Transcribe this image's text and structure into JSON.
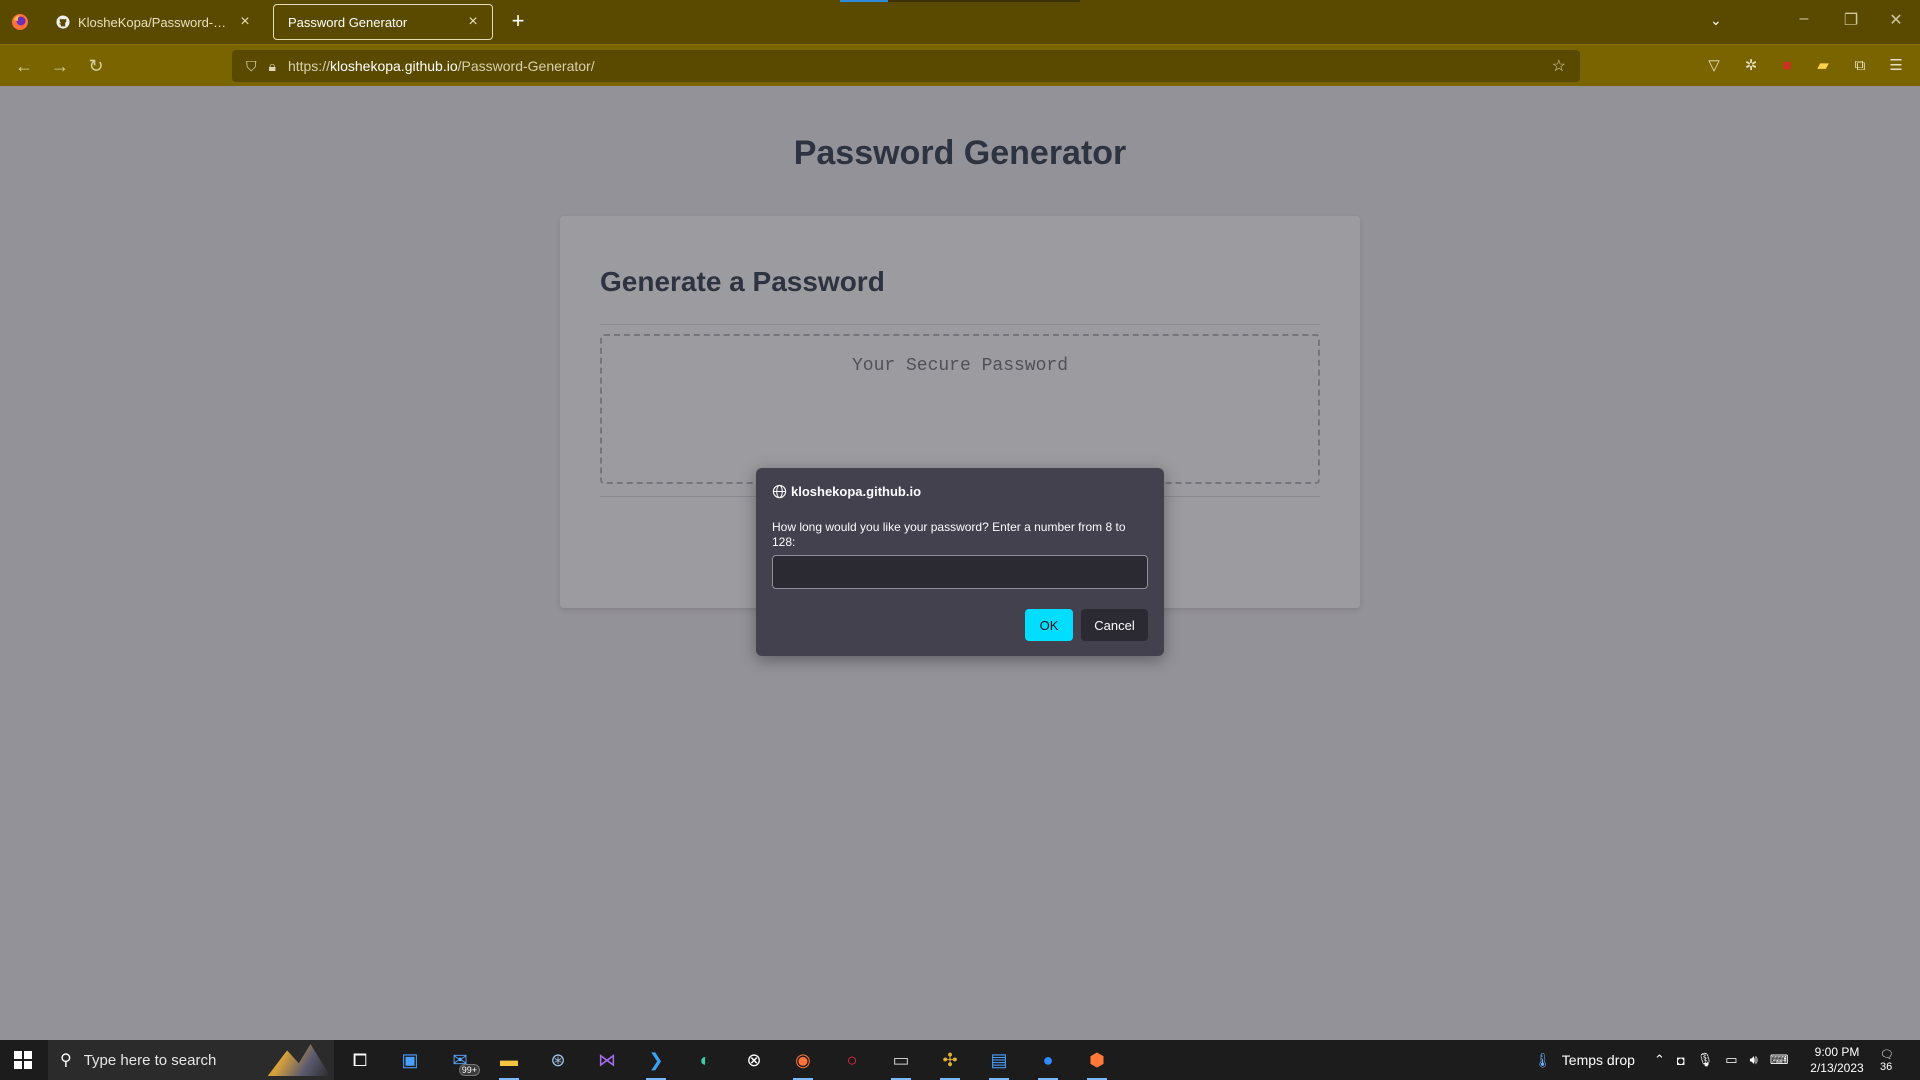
{
  "browser": {
    "tabs": [
      {
        "title": "KlosheKopa/Password-Generator",
        "icon": "github-icon"
      },
      {
        "title": "Password Generator",
        "icon": ""
      }
    ],
    "new_tab_label": "+",
    "url_prefix": "https://",
    "url_host": "kloshekopa.github.io",
    "url_path": "/Password-Generator/"
  },
  "page": {
    "title": "Password Generator",
    "card_header": "Generate a Password",
    "password_placeholder": "Your Secure Password"
  },
  "dialog": {
    "origin": "kloshekopa.github.io",
    "message": "How long would you like your password? Enter a number from 8 to 128:",
    "input_value": "",
    "ok_label": "OK",
    "cancel_label": "Cancel",
    "ok_color": "#00ddff"
  },
  "taskbar": {
    "search_placeholder": "Type here to search",
    "mail_badge": "99+",
    "weather_text": "Temps drop",
    "time": "9:00 PM",
    "date": "2/13/2023",
    "notification_count": "36"
  },
  "colors": {
    "tabbar": "#5a4a00",
    "navbar": "#7a6400",
    "page_bg": "#939298",
    "heading": "#2d3340"
  }
}
